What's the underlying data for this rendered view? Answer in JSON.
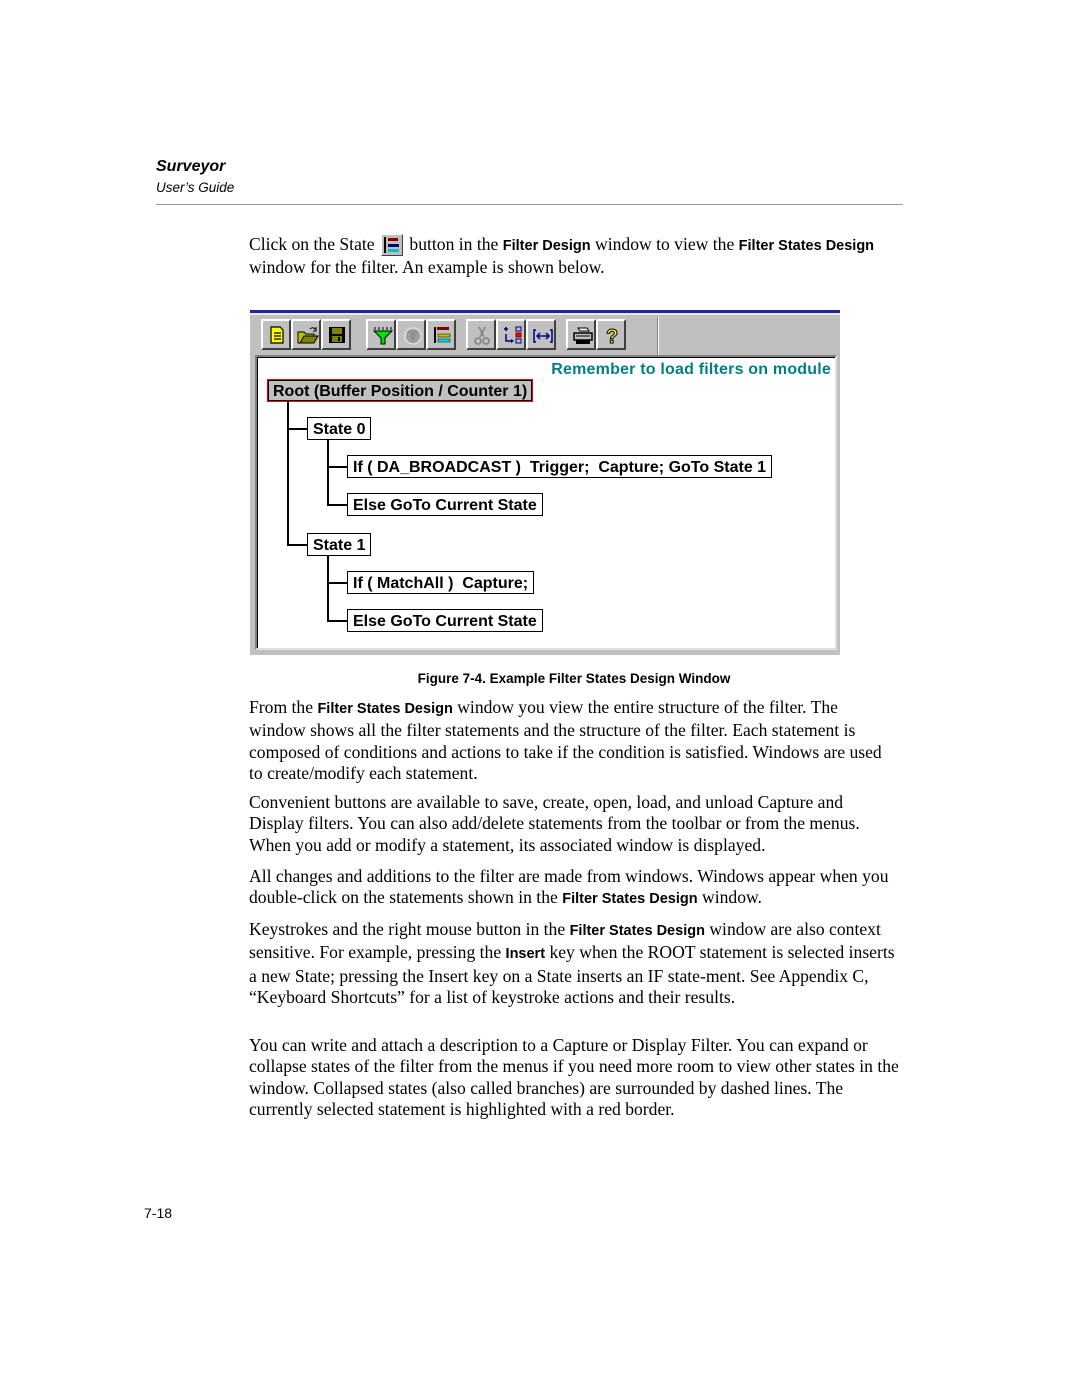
{
  "header": {
    "product": "Surveyor",
    "subtitle": "User’s Guide"
  },
  "intro": {
    "p1": "Click on the State",
    "p2": "button in the",
    "ui1": "Filter Design",
    "p3": "window to view the",
    "ui2": "Filter States Design",
    "p4": "window for the filter. An example is shown below.",
    "inline_icon": "state-tree-icon"
  },
  "window": {
    "toolbar": [
      {
        "name": "new-filter",
        "icon": "new-document-icon"
      },
      {
        "name": "open-filter",
        "icon": "open-folder-icon"
      },
      {
        "name": "save-filter",
        "icon": "floppy-disk-icon"
      },
      {
        "name": "load-filter",
        "icon": "funnel-icon"
      },
      {
        "name": "unload-filter",
        "icon": "unload-funnel-icon",
        "disabled": true
      },
      {
        "name": "state",
        "icon": "state-tree-icon"
      },
      {
        "name": "cut",
        "icon": "scissors-icon",
        "disabled": true
      },
      {
        "name": "add-statement",
        "icon": "add-statement-icon"
      },
      {
        "name": "expand",
        "icon": "expand-icon"
      },
      {
        "name": "print",
        "icon": "printer-icon"
      },
      {
        "name": "help",
        "icon": "help-question-icon"
      }
    ],
    "reminder": "Remember to load filters on module",
    "tree": {
      "root": "Root (Buffer Position / Counter 1)",
      "states": [
        {
          "label": "State 0",
          "statements": [
            "If ( DA_BROADCAST )  Trigger;  Capture; GoTo State 1",
            "Else GoTo Current State"
          ]
        },
        {
          "label": "State 1",
          "statements": [
            "If ( MatchAll )  Capture;",
            "Else GoTo Current State"
          ]
        }
      ]
    },
    "colors": {
      "reminder": "#008080",
      "selection_border": "#ff0000",
      "title_bar": "#2424a0"
    }
  },
  "caption": "Figure 7-4.  Example Filter States Design Window",
  "body": {
    "para1": {
      "a": "From the",
      "ui": "Filter States Design",
      "b": "window you view the entire structure of the filter. The window shows all the filter statements and the structure of the filter. Each statement is composed of conditions and actions to take if the condition is satisfied. Windows are used to create/modify each statement."
    },
    "para2": "Convenient buttons are available to save, create, open, load, and unload Capture and Display filters. You can also add/delete statements from the toolbar or from the menus. When you add or modify a statement, its associated window is displayed.",
    "para3": {
      "a": "All changes and additions to the filter are made from windows. Windows appear when you double-click on the statements shown in the",
      "ui": "Filter States Design",
      "b": "window."
    },
    "para4": {
      "a": "Keystrokes and the right mouse button in the",
      "ui1": "Filter States Design",
      "b": "window are also context sensitive. For example, pressing the",
      "ui2": "Insert",
      "c": "key when the ROOT statement is selected inserts a new State; pressing the Insert key on a State inserts an IF state-ment. See Appendix C, “Keyboard Shortcuts” for a list of keystroke actions and their results."
    },
    "para5": "You can write and attach a description to a Capture or Display Filter. You can expand or collapse states of the filter from the menus if you need more room to view other states in the window. Collapsed states (also called branches) are surrounded by dashed lines. The currently selected statement is highlighted with a red border."
  },
  "footer": {
    "page_number": "7-18"
  }
}
